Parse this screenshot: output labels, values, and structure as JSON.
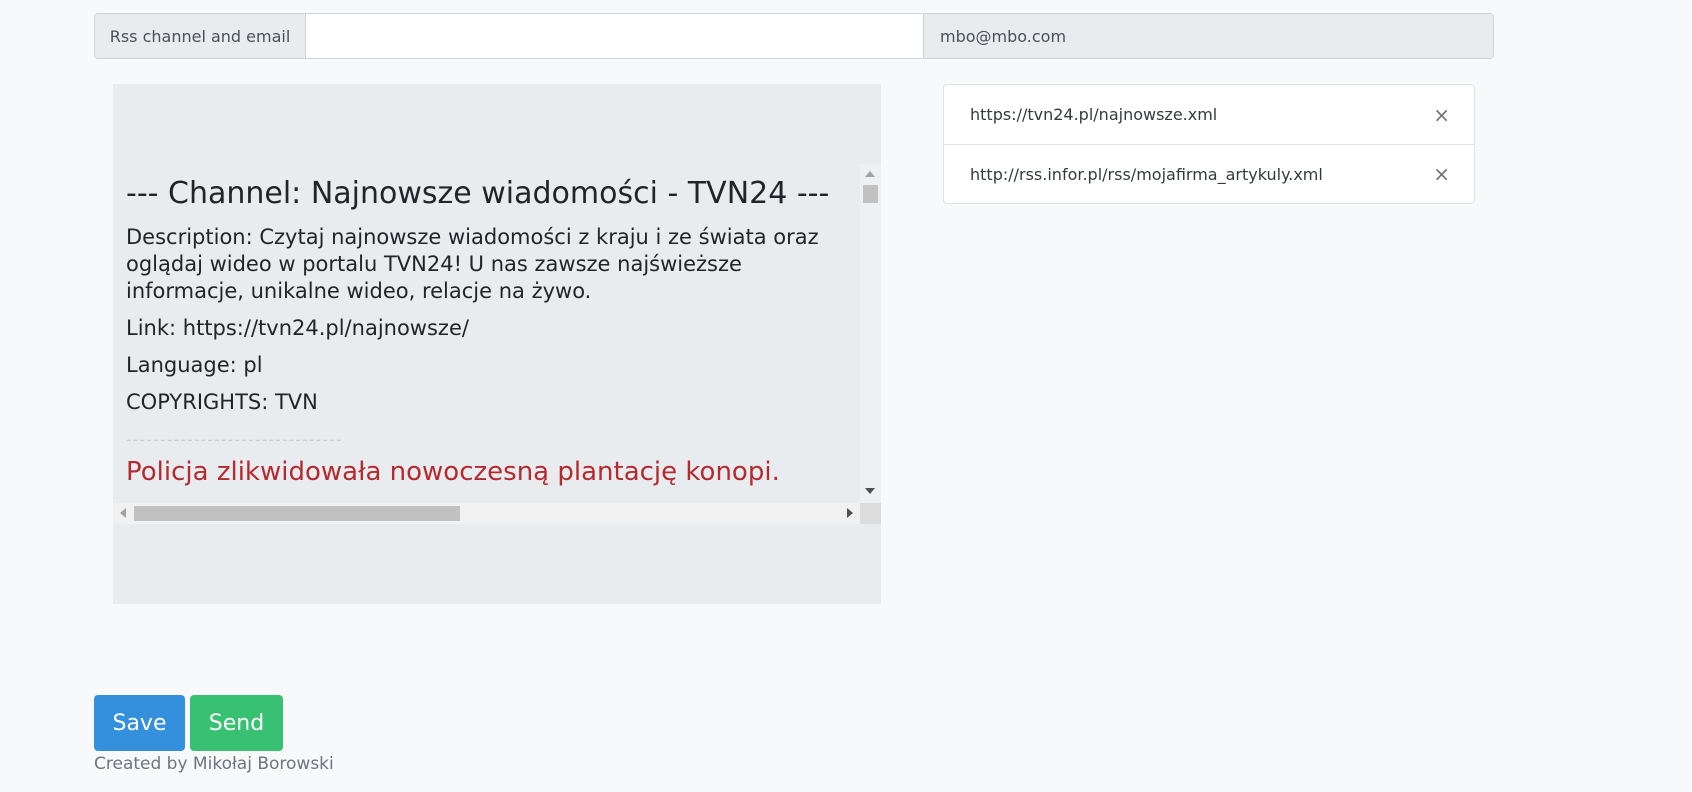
{
  "form": {
    "label": "Rss channel and email",
    "channel_input_value": "",
    "email": "mbo@mbo.com"
  },
  "feed": {
    "channel_heading": "--- Channel: Najnowsze wiadomości - TVN24 ---",
    "description": "Description: Czytaj najnowsze wiadomości z kraju i ze świata oraz oglądaj wideo w portalu TVN24! U nas zawsze najświeższe informacje, unikalne wideo, relacje na żywo.",
    "link": "Link: https://tvn24.pl/najnowsze/",
    "language": "Language: pl",
    "copyrights": "COPYRIGHTS: TVN",
    "divider": "--------------------------------",
    "first_item_title": "Policja zlikwidowała nowoczesną plantację konopi."
  },
  "channels": [
    {
      "url": "https://tvn24.pl/najnowsze.xml",
      "remove_icon": "×"
    },
    {
      "url": "http://rss.infor.pl/rss/mojafirma_artykuly.xml",
      "remove_icon": "×"
    }
  ],
  "buttons": {
    "save": "Save",
    "send": "Send"
  },
  "footer": {
    "credit": "Created by Mikołaj Borowski"
  }
}
